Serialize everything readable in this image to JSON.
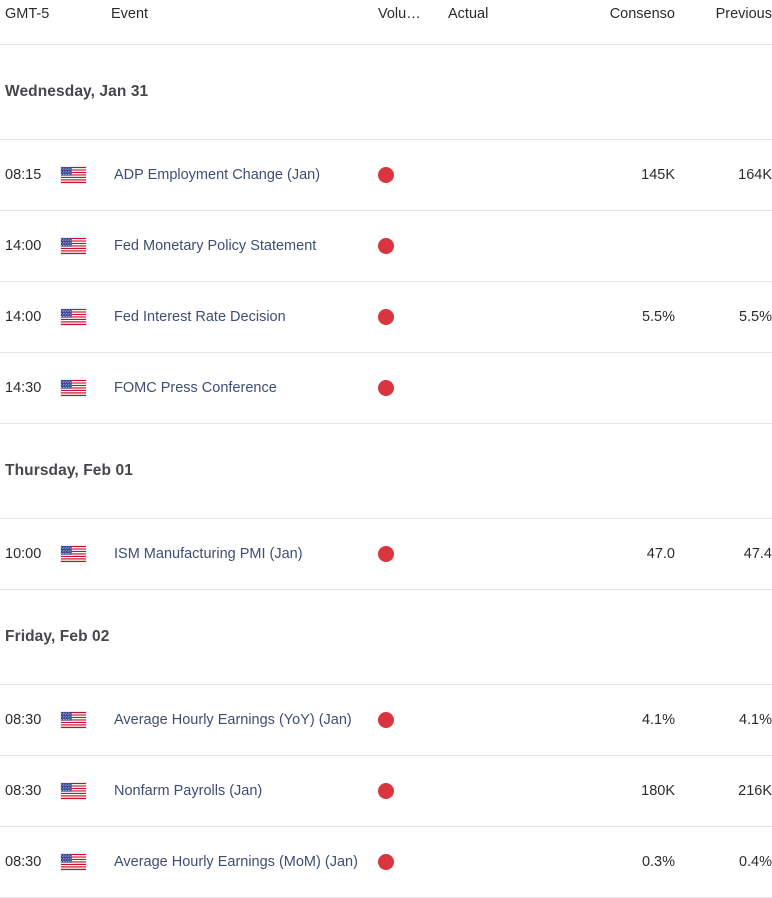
{
  "header": {
    "timezone_label": "GMT-5",
    "event_label": "Event",
    "volatility_label": "Volu…",
    "actual_label": "Actual",
    "consensus_label": "Consenso",
    "previous_label": "Previous"
  },
  "colors": {
    "volatility_high": "#d8353f",
    "event_text": "#3e4e73",
    "row_border": "#e3e5e8",
    "date_text": "#45474b",
    "flag_red": "#c8102e",
    "flag_blue": "#2c3b8f",
    "flag_white": "#ffffff"
  },
  "groups": [
    {
      "date": "Wednesday, Jan 31",
      "events": [
        {
          "time": "08:15",
          "country": "us-flag",
          "name": "ADP Employment Change (Jan)",
          "volatility": "high",
          "actual": "",
          "consensus": "145K",
          "previous": "164K"
        },
        {
          "time": "14:00",
          "country": "us-flag",
          "name": "Fed Monetary Policy Statement",
          "volatility": "high",
          "actual": "",
          "consensus": "",
          "previous": ""
        },
        {
          "time": "14:00",
          "country": "us-flag",
          "name": "Fed Interest Rate Decision",
          "volatility": "high",
          "actual": "",
          "consensus": "5.5%",
          "previous": "5.5%"
        },
        {
          "time": "14:30",
          "country": "us-flag",
          "name": "FOMC Press Conference",
          "volatility": "high",
          "actual": "",
          "consensus": "",
          "previous": ""
        }
      ]
    },
    {
      "date": "Thursday, Feb 01",
      "events": [
        {
          "time": "10:00",
          "country": "us-flag",
          "name": "ISM Manufacturing PMI (Jan)",
          "volatility": "high",
          "actual": "",
          "consensus": "47.0",
          "previous": "47.4"
        }
      ]
    },
    {
      "date": "Friday, Feb 02",
      "events": [
        {
          "time": "08:30",
          "country": "us-flag",
          "name": "Average Hourly Earnings (YoY) (Jan)",
          "volatility": "high",
          "actual": "",
          "consensus": "4.1%",
          "previous": "4.1%"
        },
        {
          "time": "08:30",
          "country": "us-flag",
          "name": "Nonfarm Payrolls (Jan)",
          "volatility": "high",
          "actual": "",
          "consensus": "180K",
          "previous": "216K"
        },
        {
          "time": "08:30",
          "country": "us-flag",
          "name": "Average Hourly Earnings (MoM) (Jan)",
          "volatility": "high",
          "actual": "",
          "consensus": "0.3%",
          "previous": "0.4%"
        }
      ]
    }
  ]
}
